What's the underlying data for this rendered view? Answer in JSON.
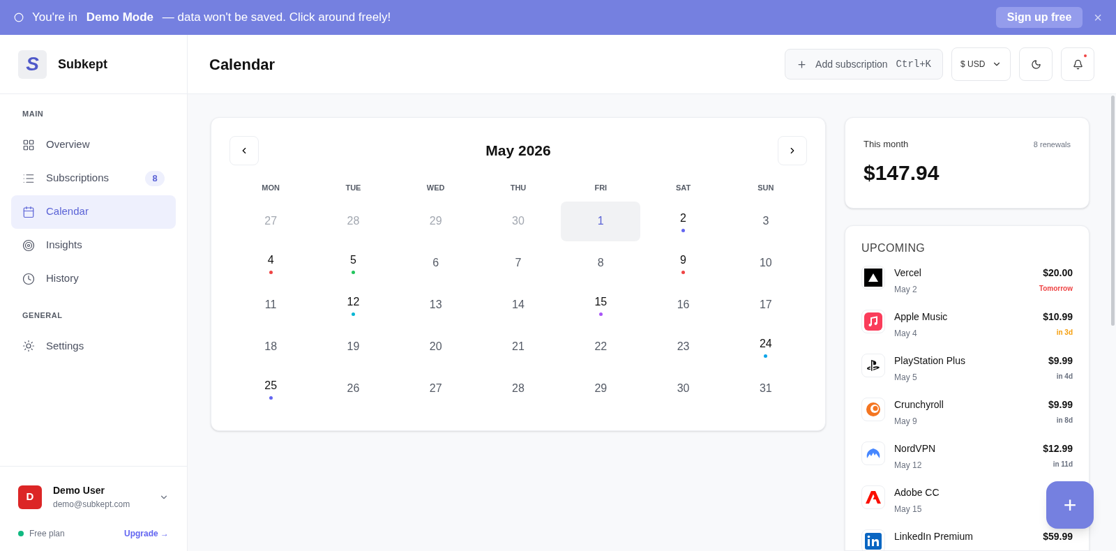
{
  "banner": {
    "text": "You're in **Demo Mode** — data won't be saved. Click around freely!",
    "button": "Sign up free",
    "close": "×"
  },
  "brand": {
    "logo": "S",
    "name": "Subkept"
  },
  "sidebar": {
    "sections": [
      {
        "title": "MAIN",
        "items": [
          {
            "label": "Overview",
            "selected": false
          },
          {
            "label": "Subscriptions",
            "selected": false,
            "badge": "8"
          },
          {
            "label": "Calendar",
            "selected": true
          },
          {
            "label": "Insights",
            "selected": false
          },
          {
            "label": "History",
            "selected": false
          }
        ]
      },
      {
        "title": "GENERAL",
        "items": [
          {
            "label": "Settings",
            "selected": false
          }
        ]
      }
    ],
    "user": {
      "initial": "D",
      "name": "Demo User",
      "email": "demo@subkept.com"
    },
    "plan": {
      "label": "Free plan",
      "color": "#10b981",
      "link": "Upgrade →"
    }
  },
  "header": {
    "title": "Calendar",
    "add_button": "Add subscription",
    "shortcut": "Ctrl+K",
    "currency": "$ USD",
    "notification_dot": true
  },
  "calendar": {
    "month": "May 2026",
    "weekdays": [
      "MON",
      "TUE",
      "WED",
      "THU",
      "FRI",
      "SAT",
      "SUN"
    ],
    "days": [
      {
        "day": "27",
        "outside": true,
        "selected": false
      },
      {
        "day": "28",
        "outside": true,
        "selected": false
      },
      {
        "day": "29",
        "outside": true,
        "selected": false
      },
      {
        "day": "30",
        "outside": true,
        "selected": false
      },
      {
        "day": "1",
        "outside": false,
        "selected": true
      },
      {
        "day": "2",
        "outside": false,
        "selected": false,
        "color": "#6366f1"
      },
      {
        "day": "3",
        "outside": false,
        "selected": false
      },
      {
        "day": "4",
        "outside": false,
        "selected": false,
        "color": "#ef4444"
      },
      {
        "day": "5",
        "outside": false,
        "selected": false,
        "color": "#22c55e"
      },
      {
        "day": "6",
        "outside": false,
        "selected": false
      },
      {
        "day": "7",
        "outside": false,
        "selected": false
      },
      {
        "day": "8",
        "outside": false,
        "selected": false
      },
      {
        "day": "9",
        "outside": false,
        "selected": false,
        "color": "#ef4444"
      },
      {
        "day": "10",
        "outside": false,
        "selected": false
      },
      {
        "day": "11",
        "outside": false,
        "selected": false
      },
      {
        "day": "12",
        "outside": false,
        "selected": false,
        "color": "#06b6d4"
      },
      {
        "day": "13",
        "outside": false,
        "selected": false
      },
      {
        "day": "14",
        "outside": false,
        "selected": false
      },
      {
        "day": "15",
        "outside": false,
        "selected": false,
        "color": "#a855f7"
      },
      {
        "day": "16",
        "outside": false,
        "selected": false
      },
      {
        "day": "17",
        "outside": false,
        "selected": false
      },
      {
        "day": "18",
        "outside": false,
        "selected": false
      },
      {
        "day": "19",
        "outside": false,
        "selected": false
      },
      {
        "day": "20",
        "outside": false,
        "selected": false
      },
      {
        "day": "21",
        "outside": false,
        "selected": false
      },
      {
        "day": "22",
        "outside": false,
        "selected": false
      },
      {
        "day": "23",
        "outside": false,
        "selected": false
      },
      {
        "day": "24",
        "outside": false,
        "selected": false,
        "color": "#0ea5e9"
      },
      {
        "day": "25",
        "outside": false,
        "selected": false,
        "color": "#6366f1"
      },
      {
        "day": "26",
        "outside": false,
        "selected": false
      },
      {
        "day": "27",
        "outside": false,
        "selected": false
      },
      {
        "day": "28",
        "outside": false,
        "selected": false
      },
      {
        "day": "29",
        "outside": false,
        "selected": false
      },
      {
        "day": "30",
        "outside": false,
        "selected": false
      },
      {
        "day": "31",
        "outside": false,
        "selected": false
      }
    ]
  },
  "summary": {
    "label": "This month",
    "count": "8 renewals",
    "total": "$147.94"
  },
  "upcoming": {
    "title": "UPCOMING",
    "items": [
      {
        "name": "Vercel",
        "date": "May 2",
        "price": "$20.00",
        "due": "Tomorrow",
        "color": "#ef4444"
      },
      {
        "name": "Apple Music",
        "date": "May 4",
        "price": "$10.99",
        "due": "in 3d",
        "color": "#f59e0b"
      },
      {
        "name": "PlayStation Plus",
        "date": "May 5",
        "price": "$9.99",
        "due": "in 4d",
        "color": "#6b7280"
      },
      {
        "name": "Crunchyroll",
        "date": "May 9",
        "price": "$9.99",
        "due": "in 8d",
        "color": "#6b7280"
      },
      {
        "name": "NordVPN",
        "date": "May 12",
        "price": "$12.99",
        "due": "in 11d",
        "color": "#6b7280"
      },
      {
        "name": "Adobe CC",
        "date": "May 15"
      },
      {
        "name": "LinkedIn Premium",
        "price": "$59.99"
      }
    ]
  },
  "fab": "+"
}
